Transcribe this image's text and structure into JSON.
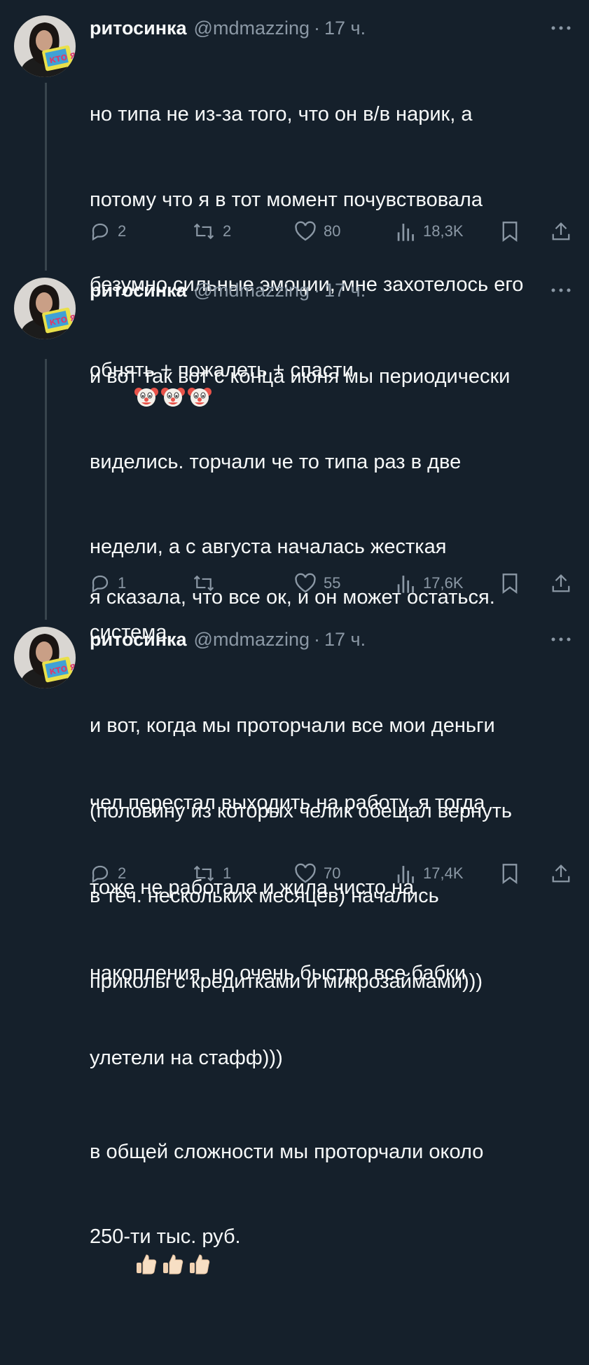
{
  "tweets": [
    {
      "author_name": "ритосинка",
      "handle": "@mdmazzing",
      "separator": "·",
      "time": "17 ч.",
      "text_lines": [
        "но типа не из-за того, что он в/в нарик, а",
        "потому что я в тот момент почувствовала",
        "безумно сильные эмоции, мне захотелось его",
        "обнять + пожалеть + спасти"
      ],
      "text_lines_2": [
        "я сказала, что все ок, и он может остаться."
      ],
      "replies": "2",
      "retweets": "2",
      "likes": "80",
      "views": "18,3K"
    },
    {
      "author_name": "ритосинка",
      "handle": "@mdmazzing",
      "separator": "·",
      "time": "17 ч.",
      "text_lines": [
        "и вот так вот с конца июня мы периодически",
        "виделись. торчали че то типа раз в две",
        "недели, а с августа началась жесткая",
        "система."
      ],
      "text_lines_2": [
        "чел перестал выходить на работу, я тогда",
        "тоже не работала и жила чисто на",
        "накопления, но очень быстро все бабки",
        "улетели на стафф)))"
      ],
      "replies": "1",
      "retweets": "",
      "likes": "55",
      "views": "17,6K"
    },
    {
      "author_name": "ритосинка",
      "handle": "@mdmazzing",
      "separator": "·",
      "time": "17 ч.",
      "text_lines": [
        "и вот, когда мы проторчали все мои деньги",
        "(половину из которых челик обещал вернуть",
        "в теч. нескольких месяцев) начались",
        "приколы с кредитками и микрозаймами)))"
      ],
      "text_lines_2": [
        "в общей сложности мы проторчали около",
        "250-ти тыс. руб."
      ],
      "replies": "2",
      "retweets": "1",
      "likes": "70",
      "views": "17,4K"
    }
  ],
  "avatar_badge_text": "КТО Я?",
  "icons": [
    "more-icon",
    "reply-icon",
    "retweet-icon",
    "like-icon",
    "views-icon",
    "bookmark-icon",
    "share-icon",
    "clown-emoji",
    "thumbs-up-emoji"
  ],
  "colors": {
    "background": "#15202b",
    "text": "#f7f9f9",
    "muted": "#8b98a5",
    "thread_line": "#38444d"
  }
}
